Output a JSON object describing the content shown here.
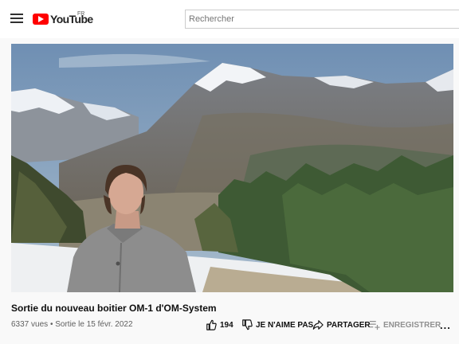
{
  "header": {
    "logo_text": "YouTube",
    "region": "FR",
    "search_placeholder": "Rechercher"
  },
  "video": {
    "title": "Sortie du nouveau boitier OM-1 d'OM-System",
    "views": "6337 vues",
    "separator": "•",
    "date": "Sortie le 15 févr. 2022"
  },
  "actions": {
    "like_count": "194",
    "dislike_label": "JE N'AIME PAS",
    "share_label": "PARTAGER",
    "save_label": "ENREGISTRER",
    "more_label": "..."
  },
  "colors": {
    "brand_red": "#ff0000",
    "text_primary": "#0f0f0f",
    "text_secondary": "#606060",
    "disabled": "#909090"
  }
}
